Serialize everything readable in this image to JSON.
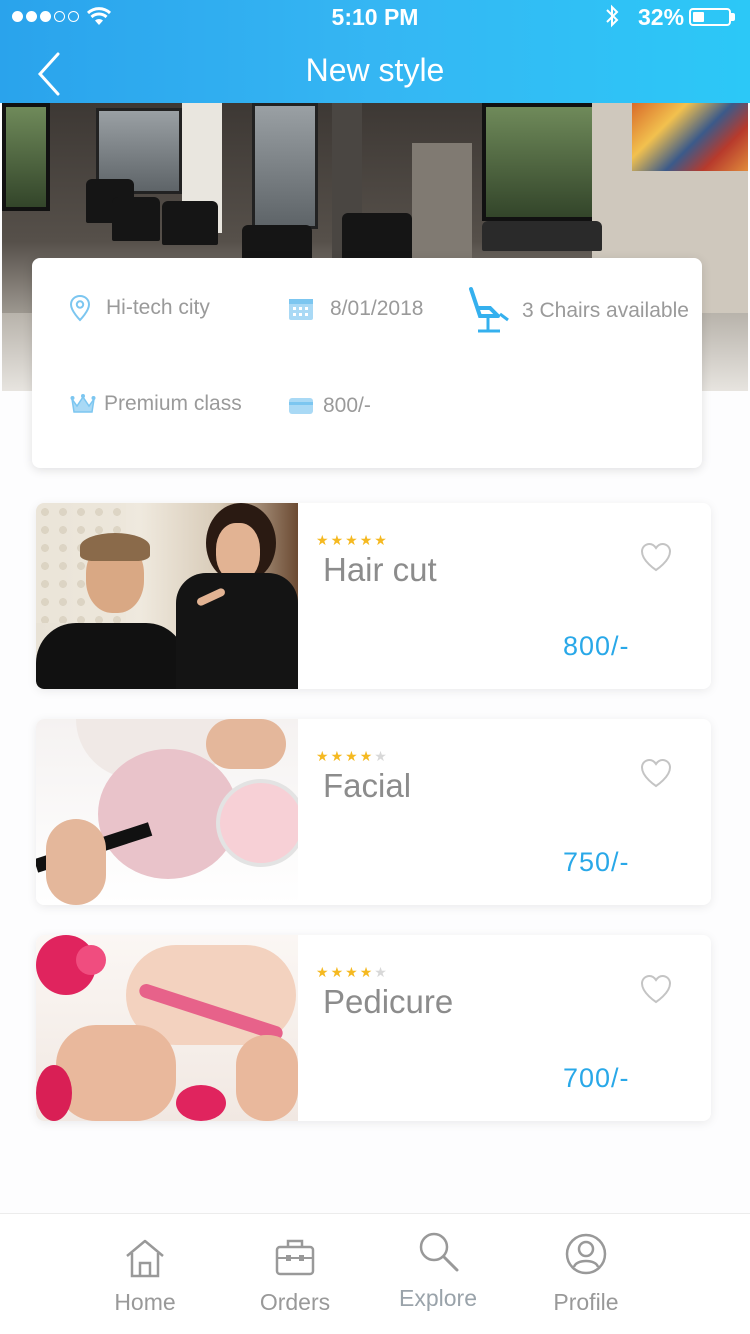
{
  "status_bar": {
    "time": "5:10 PM",
    "battery_percent": "32%",
    "battery_level": 0.32
  },
  "header": {
    "title": "New style"
  },
  "colors": {
    "header_start": "#2aa3ec",
    "header_end": "#2cc8f7",
    "price": "#29a8e8",
    "star": "#f5b921",
    "icon": "#7cc6f0"
  },
  "salon_info": {
    "location": "Hi-tech city",
    "date": "8/01/2018",
    "chairs": "3 Chairs available",
    "class": "Premium class",
    "price": "800/-"
  },
  "services": [
    {
      "name": "Hair cut",
      "price": "800/-",
      "rating": 5,
      "rating_max": 5
    },
    {
      "name": "Facial",
      "price": "750/-",
      "rating": 4,
      "rating_max": 5
    },
    {
      "name": "Pedicure",
      "price": "700/-",
      "rating": 4,
      "rating_max": 5
    }
  ],
  "bottom_nav": {
    "items": [
      {
        "label": "Home",
        "icon": "home-icon"
      },
      {
        "label": "Orders",
        "icon": "briefcase-icon"
      },
      {
        "label": "Explore",
        "icon": "search-icon"
      },
      {
        "label": "Profile",
        "icon": "user-icon"
      }
    ]
  }
}
